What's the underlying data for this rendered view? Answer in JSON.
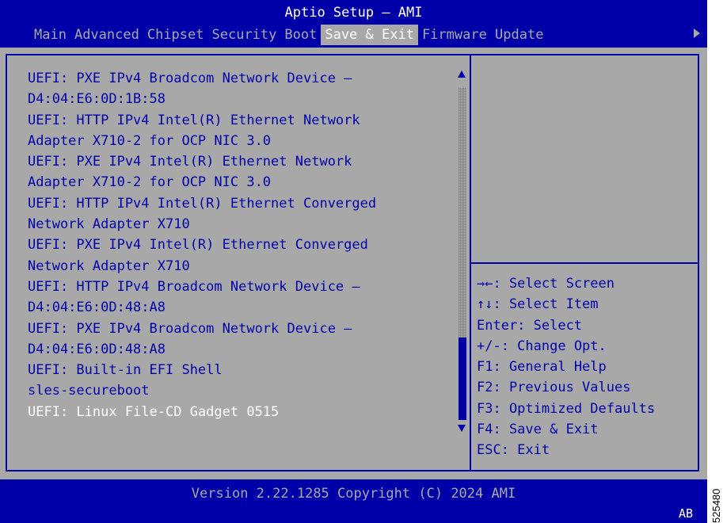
{
  "app": {
    "title": "Aptio Setup – AMI"
  },
  "menu": {
    "tabs": [
      {
        "label": "Main"
      },
      {
        "label": "Advanced"
      },
      {
        "label": "Chipset"
      },
      {
        "label": "Security"
      },
      {
        "label": "Boot"
      },
      {
        "label": "Save & Exit",
        "active": true
      },
      {
        "label": "Firmware Update"
      }
    ],
    "more_icon": "triangle-right-icon"
  },
  "boot_override": {
    "items": [
      {
        "lines": [
          "UEFI: PXE IPv4 Broadcom Network Device –",
          "D4:04:E6:0D:1B:58"
        ]
      },
      {
        "lines": [
          "UEFI: HTTP IPv4 Intel(R) Ethernet Network",
          "Adapter X710-2 for OCP NIC 3.0"
        ]
      },
      {
        "lines": [
          "UEFI: PXE IPv4 Intel(R) Ethernet Network",
          "Adapter X710-2 for OCP NIC 3.0"
        ]
      },
      {
        "lines": [
          "UEFI: HTTP IPv4 Intel(R) Ethernet Converged",
          "Network Adapter X710"
        ]
      },
      {
        "lines": [
          "UEFI: PXE IPv4 Intel(R) Ethernet Converged",
          "Network Adapter X710"
        ]
      },
      {
        "lines": [
          "UEFI: HTTP IPv4 Broadcom Network Device –",
          "D4:04:E6:0D:48:A8"
        ]
      },
      {
        "lines": [
          "UEFI: PXE IPv4 Broadcom Network Device –",
          "D4:04:E6:0D:48:A8"
        ]
      },
      {
        "lines": [
          "UEFI: Built-in EFI Shell"
        ]
      },
      {
        "lines": [
          "sles-secureboot"
        ]
      },
      {
        "lines": [
          "UEFI: Linux File-CD Gadget 0515"
        ],
        "selected": true
      }
    ]
  },
  "scrollbar": {
    "up_icon": "arrow-up-icon",
    "down_icon": "arrow-down-icon",
    "position": 0.82
  },
  "help": {
    "keys": [
      "→←: Select Screen",
      "↑↓: Select Item",
      "Enter: Select",
      "+/-: Change Opt.",
      "F1: General Help",
      "F2: Previous Values",
      "F3: Optimized Defaults",
      "F4: Save & Exit",
      "ESC: Exit"
    ]
  },
  "footer": {
    "version": "Version 2.22.1285 Copyright (C) 2024 AMI",
    "indicator": "AB"
  },
  "figure_id": "525480",
  "colors": {
    "bios_blue": "#0000a8",
    "bios_gray": "#a8a8a8",
    "highlight": "#ffffff"
  }
}
